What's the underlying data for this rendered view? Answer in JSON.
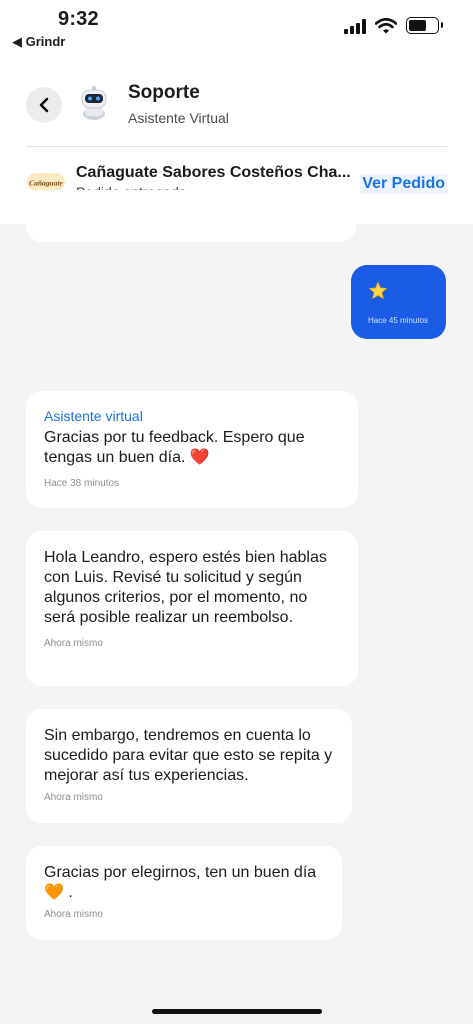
{
  "status_bar": {
    "time": "9:32",
    "back_app": "◀ Grindr",
    "icons": [
      "signal-icon",
      "wifi-icon",
      "battery-icon"
    ]
  },
  "header": {
    "title": "Soporte",
    "subtitle": "Asistente Virtual",
    "avatar_icon": "robot-icon",
    "back_icon": "chevron-left-icon"
  },
  "order": {
    "store_name": "Cañaguate Sabores Costeños Cha...",
    "status": "Pedido entregado",
    "link_label": "Ver Pedido",
    "logo_text": "Cañaguate"
  },
  "messages": [
    {
      "direction": "outgoing",
      "content_icon": "star-icon",
      "time": "Hace 45 minutos"
    },
    {
      "direction": "incoming",
      "sender": "Asistente virtual",
      "text": "Gracias por tu feedback. Espero que tengas un buen día.",
      "emoji": "❤️",
      "time": "Hace 38 minutos"
    },
    {
      "direction": "incoming",
      "text": "Hola Leandro, espero estés bien hablas con Luis. Revisé tu solicitud y según algunos criterios, por el momento, no será posible realizar un reembolso.",
      "time": "Ahora mismo"
    },
    {
      "direction": "incoming",
      "text": "Sin embargo, tendremos en cuenta lo sucedido para evitar que esto se repita y mejorar así tus experiencias.",
      "time": "Ahora mismo"
    },
    {
      "direction": "incoming",
      "text": "Gracias por elegirnos, ten un buen día",
      "emoji": "🧡",
      "suffix": ".",
      "time": "Ahora mismo"
    }
  ],
  "colors": {
    "accent": "#1a73e8",
    "sent_bubble": "#1a5ce6",
    "background": "#f4f4f6",
    "bubble": "#ffffff"
  }
}
